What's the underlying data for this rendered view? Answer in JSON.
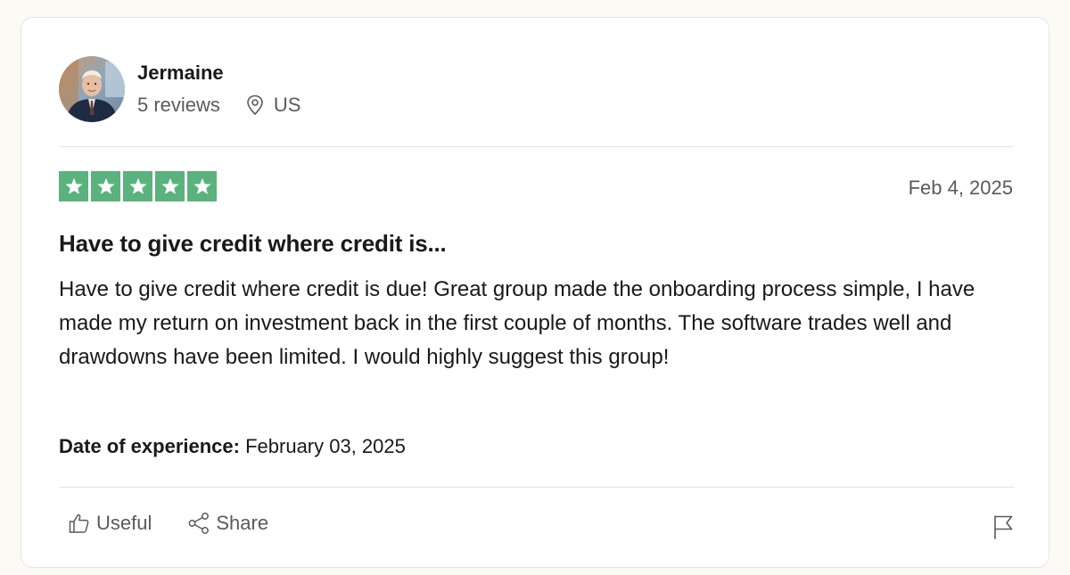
{
  "reviewer": {
    "name": "Jermaine",
    "review_count": "5 reviews",
    "location": "US"
  },
  "review": {
    "rating": 5,
    "rating_max": 5,
    "date": "Feb 4, 2025",
    "title": "Have to give credit where credit is...",
    "body": "Have to give credit where credit is due! Great group made the onboarding process simple, I have made my return on investment back in the first couple of months. The software trades well and drawdowns have been limited. I would highly suggest this group!",
    "experience_label": "Date of experience:",
    "experience_date": "February 03, 2025"
  },
  "actions": {
    "useful_label": "Useful",
    "share_label": "Share"
  },
  "colors": {
    "star_green": "#5bb27c",
    "muted_text": "#5a5a5a",
    "page_background": "#fbfaf5"
  },
  "icons": {
    "location": "location-pin-icon",
    "useful": "thumbs-up-icon",
    "share": "share-icon",
    "report": "flag-icon",
    "star": "star-icon"
  }
}
